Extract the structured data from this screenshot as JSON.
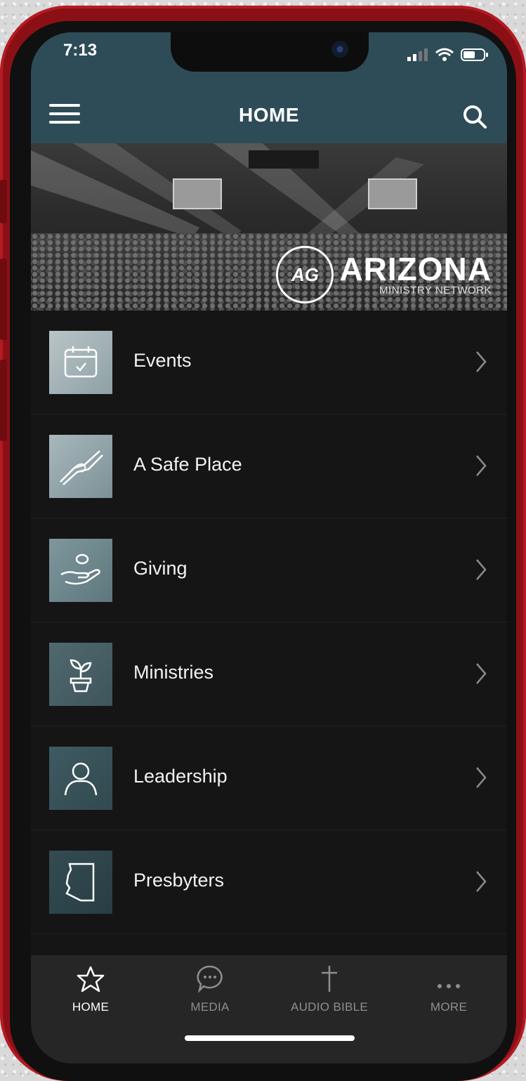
{
  "status": {
    "time": "7:13"
  },
  "header": {
    "title": "HOME"
  },
  "banner": {
    "logo_initials": "AG",
    "logo_word": "ARIZONA",
    "logo_sub": "MINISTRY NETWORK"
  },
  "menu_items": [
    {
      "label": "Events",
      "icon": "calendar-icon"
    },
    {
      "label": "A Safe Place",
      "icon": "handshake-icon"
    },
    {
      "label": "Giving",
      "icon": "giving-hand-icon"
    },
    {
      "label": "Ministries",
      "icon": "plant-icon"
    },
    {
      "label": "Leadership",
      "icon": "person-icon"
    },
    {
      "label": "Presbyters",
      "icon": "arizona-state-icon"
    }
  ],
  "tabs": [
    {
      "label": "HOME",
      "icon": "star-icon",
      "active": true
    },
    {
      "label": "MEDIA",
      "icon": "chat-bubble-icon",
      "active": false
    },
    {
      "label": "AUDIO BIBLE",
      "icon": "cross-icon",
      "active": false
    },
    {
      "label": "MORE",
      "icon": "more-dots-icon",
      "active": false
    }
  ],
  "colors": {
    "header": "#2e4c57",
    "background": "#151515",
    "tabbar": "#262626",
    "phone_frame": "#8b1016"
  }
}
